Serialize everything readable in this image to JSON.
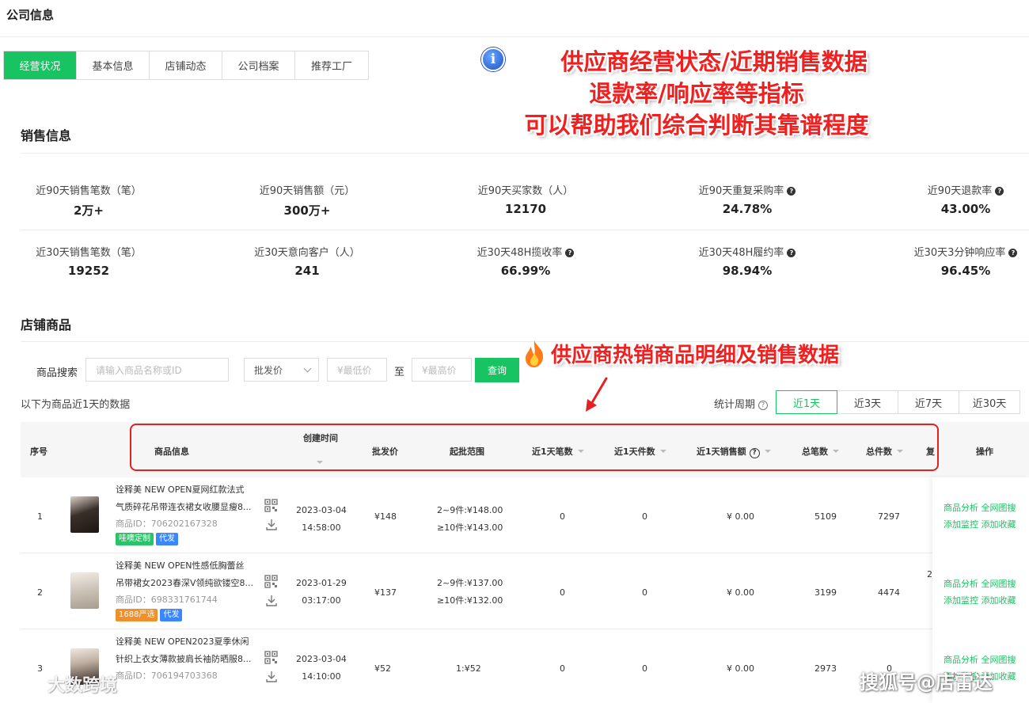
{
  "page": {
    "title": "公司信息"
  },
  "tabs": [
    {
      "label": "经营状况",
      "active": true
    },
    {
      "label": "基本信息"
    },
    {
      "label": "店铺动态"
    },
    {
      "label": "公司档案"
    },
    {
      "label": "推荐工厂"
    }
  ],
  "annotations": {
    "top": [
      "供应商经营状态/近期销售数据",
      "退款率/响应率等指标",
      "可以帮助我们综合判断其靠谱程度"
    ],
    "middle": "供应商热销商品明细及销售数据",
    "info_icon": "i"
  },
  "sales": {
    "title": "销售信息",
    "row1": [
      {
        "label": "近90天销售笔数（笔）",
        "value": "2万+"
      },
      {
        "label": "近90天销售额（元）",
        "value": "300万+"
      },
      {
        "label": "近90天买家数（人）",
        "value": "12170"
      },
      {
        "label": "近90天重复采购率",
        "value": "24.78%",
        "help": "?"
      },
      {
        "label": "近90天退款率",
        "value": "43.00%",
        "help": "?"
      }
    ],
    "row2": [
      {
        "label": "近30天销售笔数（笔）",
        "value": "19252"
      },
      {
        "label": "近30天意向客户（人）",
        "value": "241"
      },
      {
        "label": "近30天48H揽收率",
        "value": "66.99%",
        "help": "?"
      },
      {
        "label": "近30天48H履约率",
        "value": "98.94%",
        "help": "?"
      },
      {
        "label": "近30天3分钟响应率",
        "value": "96.45%",
        "help": "?"
      }
    ]
  },
  "shop": {
    "title": "店铺商品",
    "search_label": "商品搜索",
    "search_placeholder": "请输入商品名称或ID",
    "price_type": "批发价",
    "min_placeholder": "¥最低价",
    "to_label": "至",
    "max_placeholder": "¥最高价",
    "query_label": "查询",
    "data_note": "以下为商品近1天的数据",
    "period_label": "统计周期",
    "period_help": "?",
    "periods": [
      "近1天",
      "近3天",
      "近7天",
      "近30天"
    ],
    "active_period": 0
  },
  "table": {
    "headers": {
      "seq": "序号",
      "info": "商品信息",
      "created": "创建时间",
      "price": "批发价",
      "range": "起批范围",
      "orders1d": "近1天笔数",
      "pieces1d": "近1天件数",
      "sales1d": "近1天销售额",
      "orders": "总笔数",
      "pieces": "总件数",
      "more": "复",
      "ops": "操作",
      "sales_help": "?"
    },
    "rows": [
      {
        "seq": "1",
        "title1": "诠释美 NEW OPEN夏网红款法式",
        "title2": "气质碎花吊带连衣裙女收腰显瘦8...",
        "pid": "商品ID：706202167328",
        "tags": [
          {
            "text": "哇噢定制",
            "color": "green"
          },
          {
            "text": "代发",
            "color": "blue"
          }
        ],
        "date": "2023-03-04",
        "time": "14:58:00",
        "price": "¥148",
        "range1": "2~9件:¥148.00",
        "range2": "≥10件:¥143.00",
        "orders1d": "0",
        "pieces1d": "0",
        "sales1d": "¥ 0.00",
        "orders": "5109",
        "pieces": "7297",
        "overflow": ""
      },
      {
        "seq": "2",
        "title1": "诠释美 NEW OPEN性感低胸蕾丝",
        "title2": "吊带裙女2023春深V领纯欲镂空8...",
        "pid": "商品ID：698331761744",
        "tags": [
          {
            "text": "1688严选",
            "color": "orange"
          },
          {
            "text": "代发",
            "color": "blue"
          }
        ],
        "date": "2023-01-29",
        "time": "03:17:00",
        "price": "¥137",
        "range1": "2~9件:¥137.00",
        "range2": "≥10件:¥132.00",
        "orders1d": "0",
        "pieces1d": "0",
        "sales1d": "¥ 0.00",
        "orders": "3199",
        "pieces": "4474",
        "overflow": "2"
      },
      {
        "seq": "3",
        "title1": "诠释美 NEW OPEN2023夏季休闲",
        "title2": "针织上衣女薄款披肩长袖防晒服8...",
        "pid": "商品ID：706194703368",
        "tags": [],
        "date": "2023-03-04",
        "time": "14:10:00",
        "price": "¥52",
        "range1": "1:¥52",
        "range2": "",
        "orders1d": "0",
        "pieces1d": "0",
        "sales1d": "¥ 0.00",
        "orders": "2973",
        "pieces": "0",
        "overflow": ""
      }
    ],
    "ops": {
      "analysis": "商品分析",
      "image_search": "全网图搜",
      "monitor": "添加监控",
      "favorite": "添加收藏"
    }
  },
  "watermarks": {
    "left": "大数跨境",
    "right": "搜狐号@店雷达"
  },
  "colors": {
    "accent": "#18c462",
    "annotation": "#f02020",
    "tag_blue": "#3a86ff",
    "tag_orange": "#f0902a"
  }
}
